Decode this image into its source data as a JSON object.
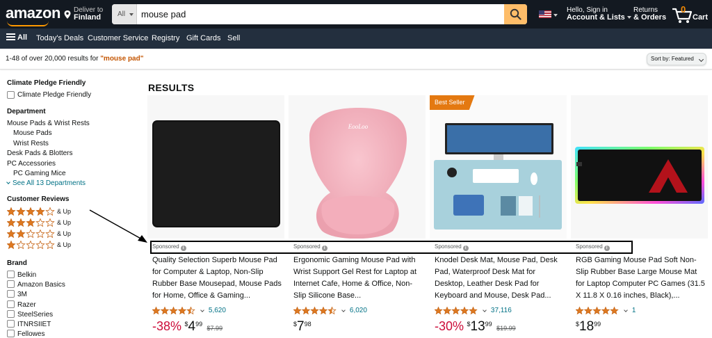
{
  "header": {
    "logo": "amazon",
    "deliver_line1": "Deliver to",
    "deliver_line2": "Finland",
    "search_category": "All",
    "search_value": "mouse pad",
    "account_line1": "Hello, Sign in",
    "account_line2": "Account & Lists",
    "orders_line1": "Returns",
    "orders_line2": "& Orders",
    "cart_count": "0",
    "cart_label": "Cart"
  },
  "subnav": {
    "all": "All",
    "links": [
      "Today's Deals",
      "Customer Service",
      "Registry",
      "Gift Cards",
      "Sell"
    ]
  },
  "results_bar": {
    "count_text": "1-48 of over 20,000 results for ",
    "query": "\"mouse pad\"",
    "sort_label": "Sort by:",
    "sort_value": "Featured"
  },
  "sidebar": {
    "climate_heading": "Climate Pledge Friendly",
    "climate_option": "Climate Pledge Friendly",
    "department_heading": "Department",
    "departments": [
      "Mouse Pads & Wrist Rests",
      "Mouse Pads",
      "Wrist Rests",
      "Desk Pads & Blotters",
      "PC Accessories",
      "PC Gaming Mice"
    ],
    "see_all": "See All 13 Departments",
    "reviews_heading": "Customer Reviews",
    "review_rows": [
      {
        "stars": 4,
        "label": "& Up"
      },
      {
        "stars": 3,
        "label": "& Up"
      },
      {
        "stars": 2,
        "label": "& Up"
      },
      {
        "stars": 1,
        "label": "& Up"
      }
    ],
    "brand_heading": "Brand",
    "brands": [
      "Belkin",
      "Amazon Basics",
      "3M",
      "Razer",
      "SteelSeries",
      "ITNRSIIET",
      "Fellowes"
    ]
  },
  "results_title": "RESULTS",
  "products": [
    {
      "badge": "",
      "sponsored": "Sponsored",
      "title": "Quality Selection Superb Mouse Pad for Computer & Laptop, Non-Slip Rubber Base Mousepad, Mouse Pads for Home, Office & Gaming...",
      "rating": 4.5,
      "review_count": "5,620",
      "discount": "-38%",
      "currency": "$",
      "price_whole": "4",
      "price_fraction": "99",
      "list_price": "$7.99"
    },
    {
      "badge": "",
      "sponsored": "Sponsored",
      "title": "Ergonomic Gaming Mouse Pad with Wrist Support Gel Rest for Laptop at Internet Cafe, Home & Office, Non-Slip Silicone Base...",
      "rating": 4.5,
      "review_count": "6,020",
      "discount": "",
      "currency": "$",
      "price_whole": "7",
      "price_fraction": "98",
      "list_price": ""
    },
    {
      "badge": "Best Seller",
      "sponsored": "Sponsored",
      "title": "Knodel Desk Mat, Mouse Pad, Desk Pad, Waterproof Desk Mat for Desktop, Leather Desk Pad for Keyboard and Mouse, Desk Pad...",
      "rating": 5,
      "review_count": "37,116",
      "discount": "-30%",
      "currency": "$",
      "price_whole": "13",
      "price_fraction": "99",
      "list_price": "$19.99"
    },
    {
      "badge": "",
      "sponsored": "Sponsored",
      "title": "RGB Gaming Mouse Pad Soft Non-Slip Rubber Base Large Mouse Mat for Laptop Computer PC Games (31.5 X 11.8 X 0.16 inches, Black),...",
      "rating": 5,
      "review_count": "1",
      "discount": "",
      "currency": "$",
      "price_whole": "18",
      "price_fraction": "99",
      "list_price": ""
    }
  ],
  "colors": {
    "nav_dark": "#131921",
    "nav_sub": "#232f3e",
    "accent_orange": "#febd69",
    "link_teal": "#007185",
    "deal_red": "#cc0c39",
    "star": "#de7921",
    "badge_orange": "#e47911"
  }
}
